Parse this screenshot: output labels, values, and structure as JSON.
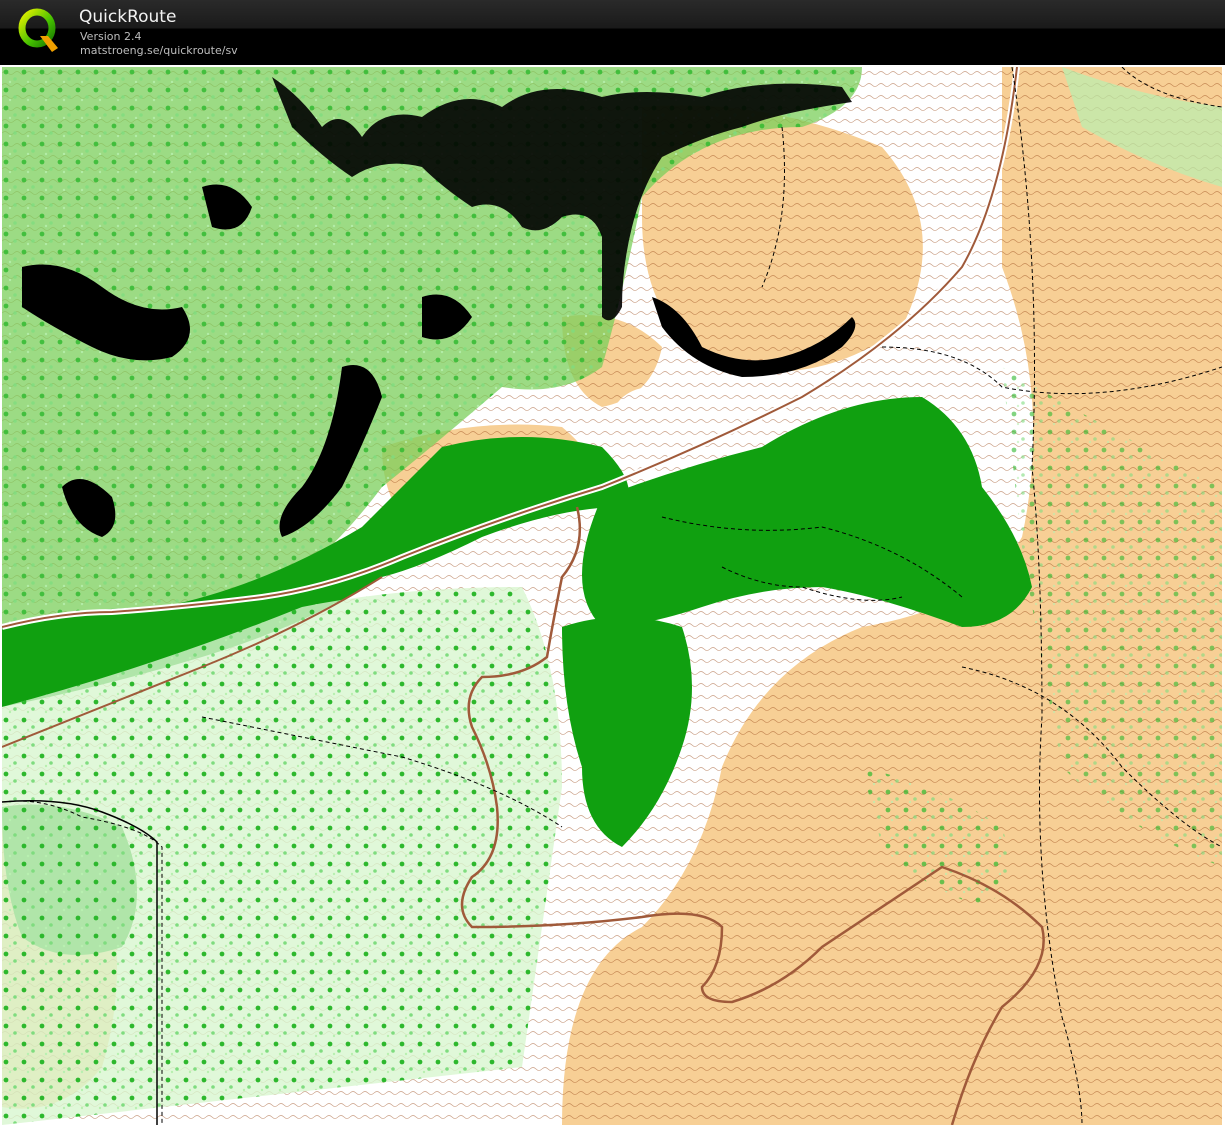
{
  "header": {
    "app_name": "QuickRoute",
    "version": "Version 2.4",
    "url": "matstroeng.se/quickroute/sv"
  },
  "icons": {
    "logo": "quickroute-q-logo"
  },
  "colors": {
    "header_bg": "#000000",
    "open_land": "#f7cf95",
    "forest_dark": "#10a010",
    "forest_medium": "#4cc84c",
    "forest_light": "#b8f0b0",
    "contour": "#9a4a1c",
    "cliff": "#000000",
    "road": "#a05a3a"
  }
}
